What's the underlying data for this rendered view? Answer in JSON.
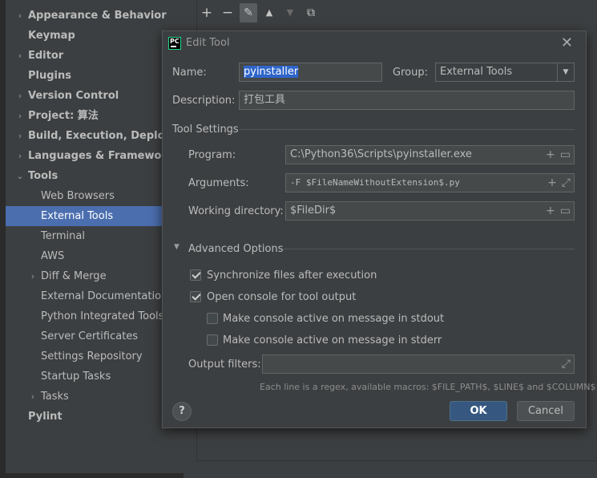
{
  "sidebar": {
    "items": [
      {
        "label": "Appearance & Behavior",
        "arrow": "›",
        "bold": true
      },
      {
        "label": "Keymap",
        "arrow": "",
        "bold": true
      },
      {
        "label": "Editor",
        "arrow": "›",
        "bold": true
      },
      {
        "label": "Plugins",
        "arrow": "",
        "bold": true
      },
      {
        "label": "Version Control",
        "arrow": "›",
        "bold": true
      },
      {
        "label": "Project: 算法",
        "arrow": "›",
        "bold": true
      },
      {
        "label": "Build, Execution, Deployme",
        "arrow": "›",
        "bold": true
      },
      {
        "label": "Languages & Frameworks",
        "arrow": "›",
        "bold": true
      },
      {
        "label": "Tools",
        "arrow": "⌄",
        "bold": true
      },
      {
        "label": "Web Browsers",
        "arrow": "",
        "bold": false
      },
      {
        "label": "External Tools",
        "arrow": "",
        "bold": false,
        "selected": true
      },
      {
        "label": "Terminal",
        "arrow": "",
        "bold": false
      },
      {
        "label": "AWS",
        "arrow": "",
        "bold": false
      },
      {
        "label": "Diff & Merge",
        "arrow": "›",
        "bold": false
      },
      {
        "label": "External Documentation",
        "arrow": "",
        "bold": false
      },
      {
        "label": "Python Integrated Tools",
        "arrow": "",
        "bold": false
      },
      {
        "label": "Server Certificates",
        "arrow": "",
        "bold": false
      },
      {
        "label": "Settings Repository",
        "arrow": "",
        "bold": false
      },
      {
        "label": "Startup Tasks",
        "arrow": "",
        "bold": false
      },
      {
        "label": "Tasks",
        "arrow": "›",
        "bold": false
      },
      {
        "label": "Pylint",
        "arrow": "",
        "bold": true
      }
    ]
  },
  "toolbar": {
    "add": "+",
    "remove": "−",
    "edit": "✎",
    "up": "▲",
    "down": "▼",
    "copy": "⧉"
  },
  "dialog": {
    "logo": "PC",
    "title": "Edit Tool",
    "close": "✕",
    "name_label": "Name:",
    "name_value": "pyinstaller",
    "group_label": "Group:",
    "group_value": "External Tools",
    "description_label": "Description:",
    "description_value": "打包工具",
    "tool_settings": "Tool Settings",
    "program_label": "Program:",
    "program_value": "C:\\Python36\\Scripts\\pyinstaller.exe",
    "arguments_label": "Arguments:",
    "arguments_value": "-F $FileNameWithoutExtension$.py",
    "workdir_label": "Working directory:",
    "workdir_value": "$FileDir$",
    "advanced_options": "Advanced Options",
    "sync_files": "Synchronize files after execution",
    "open_console": "Open console for tool output",
    "console_stdout": "Make console active on message in stdout",
    "console_stderr": "Make console active on message in stderr",
    "output_filters_label": "Output filters:",
    "hint": "Each line is a regex, available macros: $FILE_PATH$, $LINE$ and $COLUMN$",
    "help": "?",
    "ok": "OK",
    "cancel": "Cancel"
  },
  "checkboxes": {
    "sync_files": true,
    "open_console": true,
    "console_stdout": false,
    "console_stderr": false
  }
}
